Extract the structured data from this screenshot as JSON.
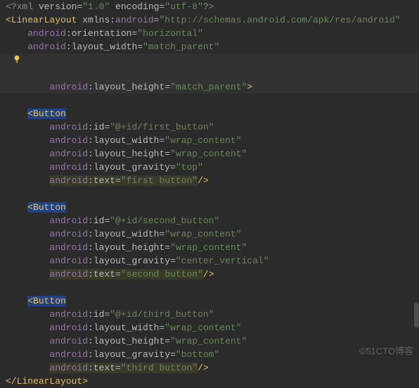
{
  "xml_decl": {
    "open": "<?",
    "name": "xml",
    "attrs": " version=",
    "v1": "\"1.0\"",
    "attrs2": " encoding=",
    "v2": "\"utf-8\"",
    "close": "?>"
  },
  "root": {
    "open": "<",
    "tag": "LinearLayout",
    "ns_attr": " xmlns:",
    "ns_name": "android",
    "eq": "=",
    "ns_val": "\"http://schemas.android.com/apk/res/android\"",
    "attrs": {
      "orientation": {
        "ns": "android",
        "name": ":orientation",
        "val": "\"horizontal\""
      },
      "layout_width": {
        "ns": "android",
        "name": ":layout_width",
        "val": "\"match_parent\""
      },
      "layout_height": {
        "ns": "android",
        "name": ":layout_height",
        "val": "\"match_parent\"",
        "close": ">"
      }
    }
  },
  "buttons": [
    {
      "tag": "Button",
      "attrs": {
        "id": {
          "ns": "android",
          "name": ":id",
          "val": "\"@+id/first_button\""
        },
        "layout_width": {
          "ns": "android",
          "name": ":layout_width",
          "val": "\"wrap_content\""
        },
        "layout_height": {
          "ns": "android",
          "name": ":layout_height",
          "val": "\"wrap_content\""
        },
        "layout_gravity": {
          "ns": "android",
          "name": ":layout_gravity",
          "val": "\"top\""
        },
        "text": {
          "ns": "android",
          "name": ":text",
          "val": "\"first button\"",
          "close": "/>"
        }
      }
    },
    {
      "tag": "Button",
      "attrs": {
        "id": {
          "ns": "android",
          "name": ":id",
          "val": "\"@+id/second_button\""
        },
        "layout_width": {
          "ns": "android",
          "name": ":layout_width",
          "val": "\"wrap_content\""
        },
        "layout_height": {
          "ns": "android",
          "name": ":layout_height",
          "val": "\"wrap_content\""
        },
        "layout_gravity": {
          "ns": "android",
          "name": ":layout_gravity",
          "val": "\"center_vertical\""
        },
        "text": {
          "ns": "android",
          "name": ":text",
          "val": "\"second button\"",
          "close": "/>"
        }
      }
    },
    {
      "tag": "Button",
      "attrs": {
        "id": {
          "ns": "android",
          "name": ":id",
          "val": "\"@+id/third_button\""
        },
        "layout_width": {
          "ns": "android",
          "name": ":layout_width",
          "val": "\"wrap_content\""
        },
        "layout_height": {
          "ns": "android",
          "name": ":layout_height",
          "val": "\"wrap_content\""
        },
        "layout_gravity": {
          "ns": "android",
          "name": ":layout_gravity",
          "val": "\"bottom\""
        },
        "text": {
          "ns": "android",
          "name": ":text",
          "val": "\"third button\"",
          "close": "/>"
        }
      }
    }
  ],
  "root_close": {
    "open": "</",
    "tag": "LinearLayout",
    "close": ">"
  },
  "watermark": "©51CTO博客",
  "indent": {
    "i1": "    ",
    "i2": "        "
  }
}
